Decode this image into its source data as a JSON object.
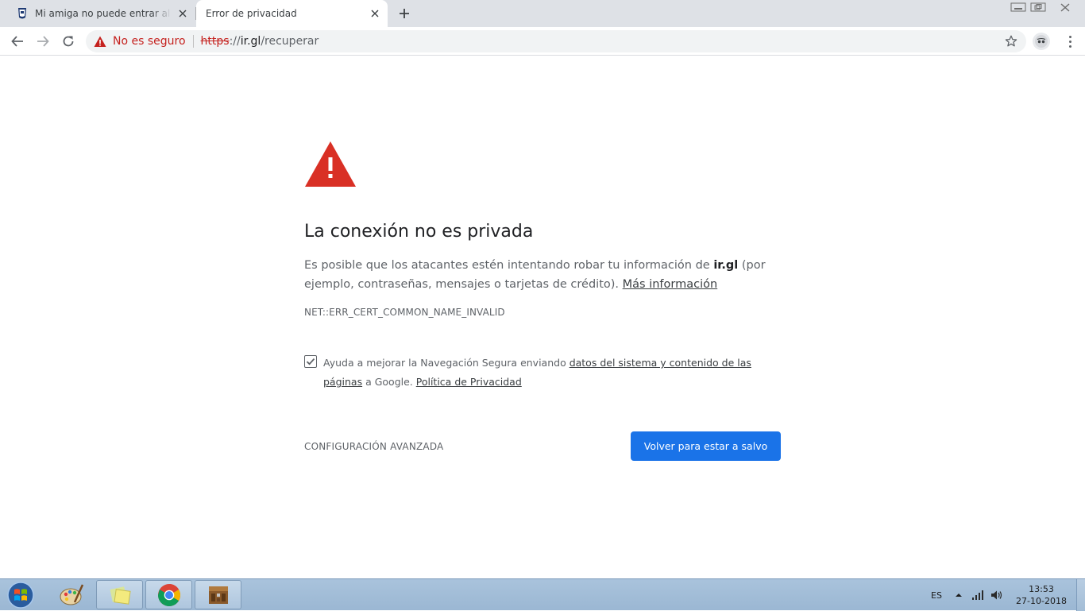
{
  "browser": {
    "tabs": [
      {
        "title": "Mi amiga no puede entrar al serv",
        "active": false
      },
      {
        "title": "Error de privacidad",
        "active": true
      }
    ],
    "omnibox": {
      "security_label": "No es seguro",
      "scheme": "https",
      "separator": "://",
      "host": "ir.gl",
      "path": "/recuperar"
    }
  },
  "interstitial": {
    "heading": "La conexión no es privada",
    "body_intro": "Es posible que los atacantes estén intentando robar tu información de ",
    "body_domain": "ir.gl",
    "body_rest": " (por ejemplo, contraseñas, mensajes o tarjetas de crédito). ",
    "learn_more": "Más información",
    "error_code": "NET::ERR_CERT_COMMON_NAME_INVALID",
    "optin": {
      "checked": true,
      "text_before": "Ayuda a mejorar la Navegación Segura enviando ",
      "link_data": "datos del sistema y contenido de las páginas",
      "text_middle": " a Google. ",
      "link_privacy": "Política de Privacidad"
    },
    "advanced_label": "CONFIGURACIÓN AVANZADA",
    "primary_button": "Volver para estar a salvo"
  },
  "taskbar": {
    "language": "ES",
    "time": "13:53",
    "date": "27-10-2018"
  },
  "colors": {
    "warning_red": "#d93025",
    "primary_blue": "#1a73e8",
    "tabstrip_bg": "#dee1e6",
    "taskbar_bg": "#a9c3dc"
  },
  "icons": [
    "back-arrow-icon",
    "forward-arrow-icon",
    "reload-icon",
    "warning-triangle-icon",
    "star-icon",
    "avatar-icon",
    "menu-icon",
    "plus-icon",
    "close-icon",
    "windows-start-icon",
    "chrome-icon"
  ]
}
